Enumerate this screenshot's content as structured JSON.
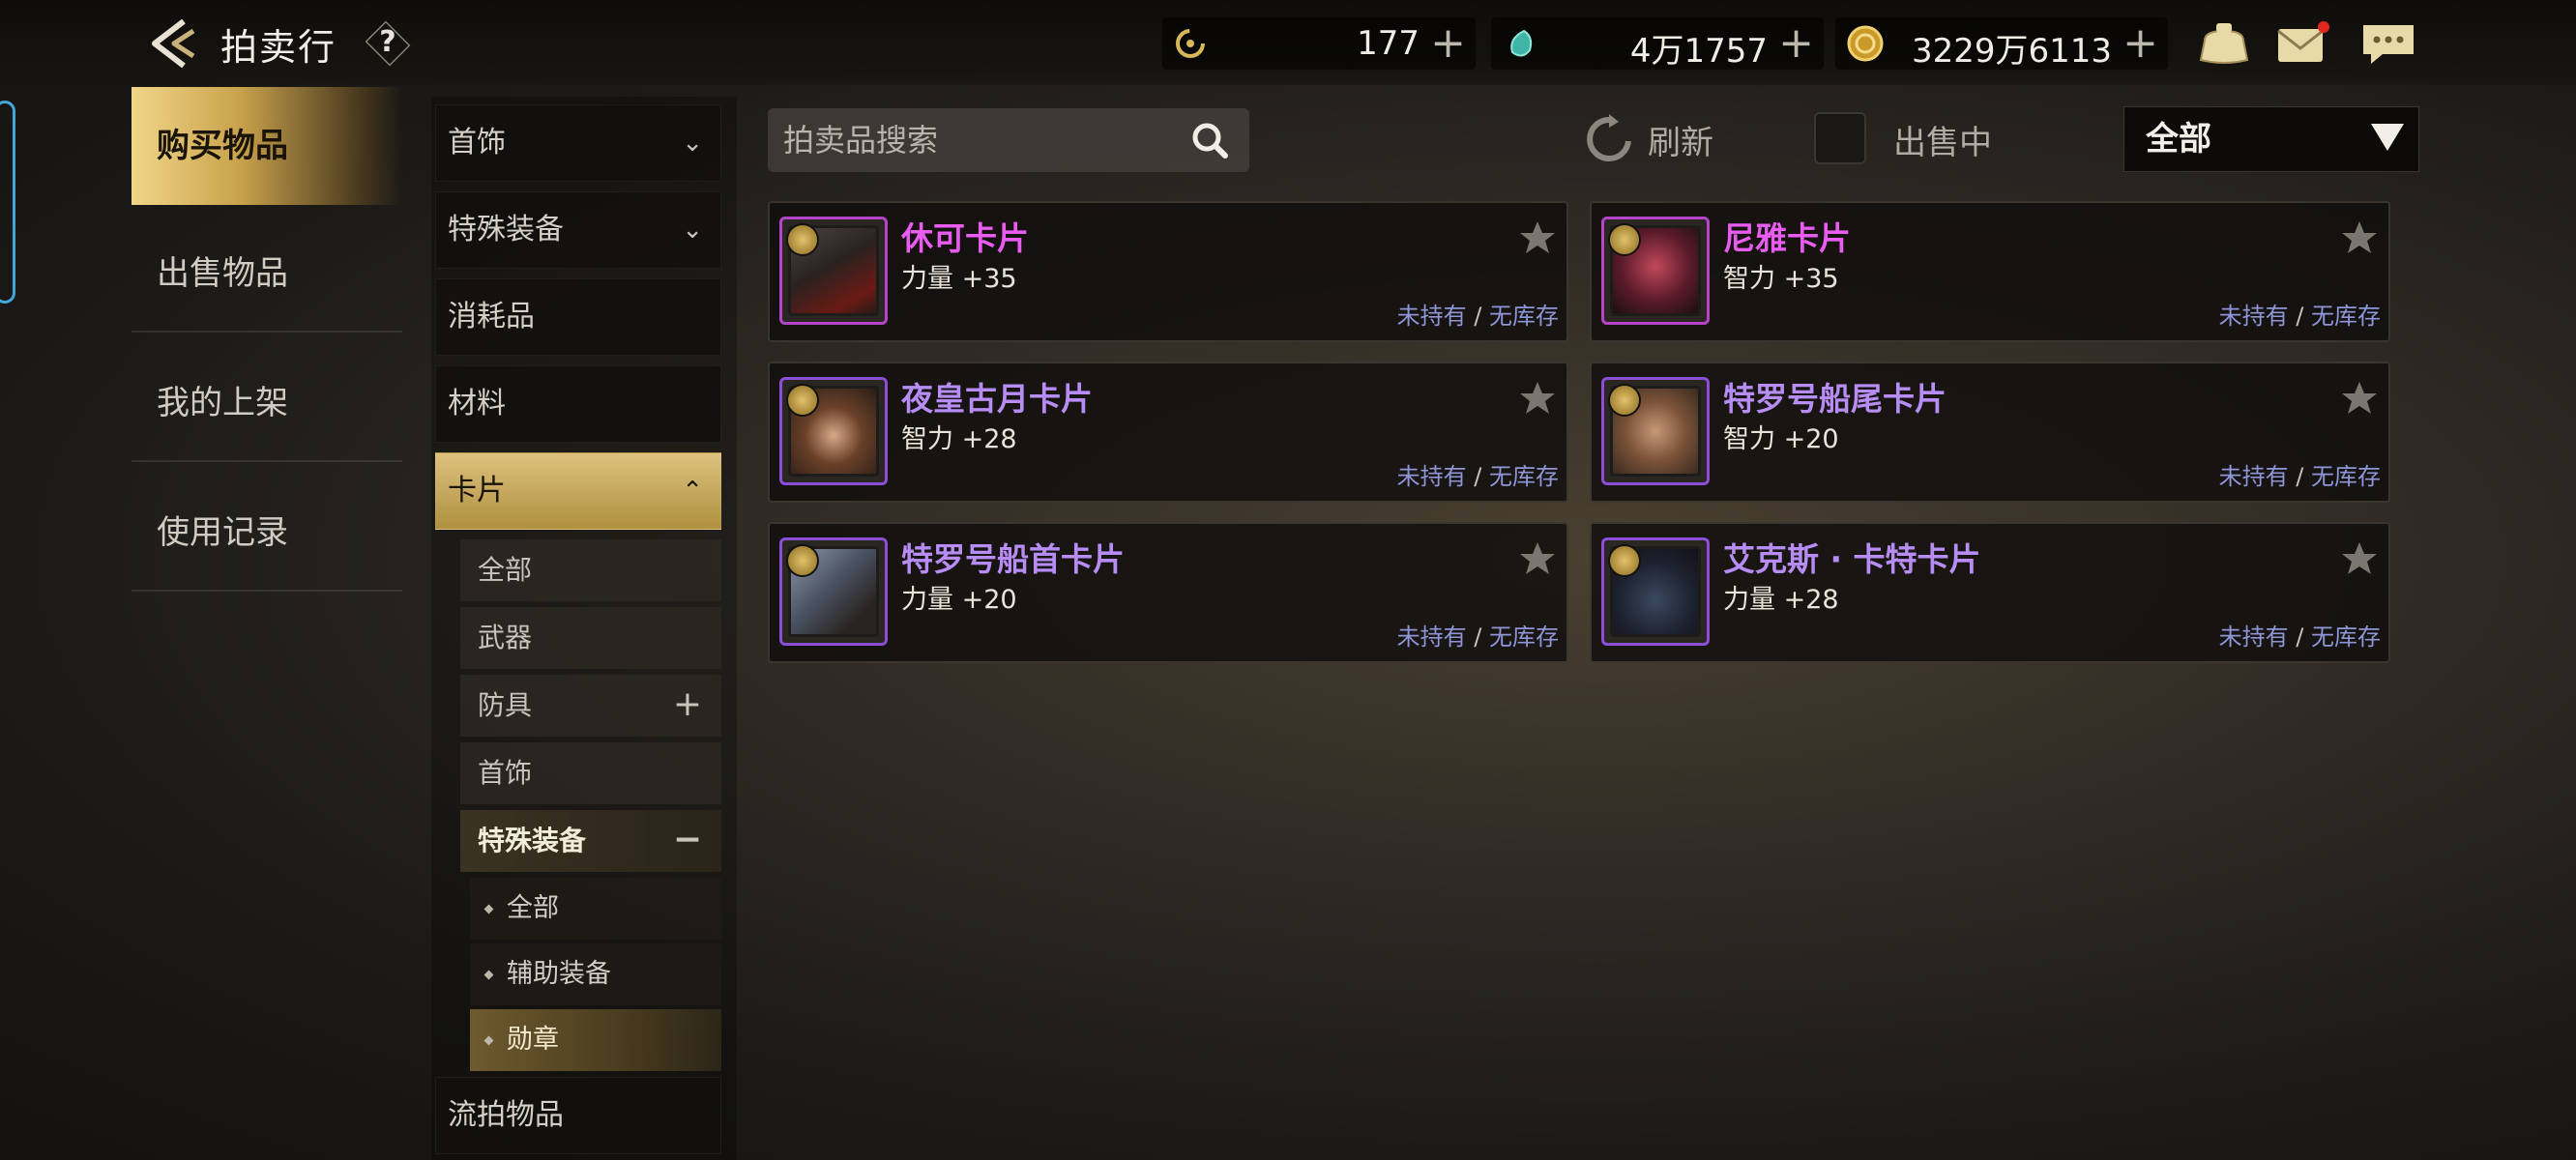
{
  "header": {
    "title": "拍卖行",
    "help_label": "?",
    "currencies": [
      {
        "icon": "ticket-coin-icon",
        "value": "177",
        "plus": "+"
      },
      {
        "icon": "crystal-gem-icon",
        "value": "4万1757",
        "plus": "+"
      },
      {
        "icon": "gold-coin-icon",
        "value": "3229万6113",
        "plus": "+"
      }
    ],
    "icons": [
      "bag-icon",
      "mail-icon",
      "chat-icon"
    ]
  },
  "left_nav": {
    "items": [
      {
        "label": "购买物品",
        "active": true
      },
      {
        "label": "出售物品",
        "active": false
      },
      {
        "label": "我的上架",
        "active": false
      },
      {
        "label": "使用记录",
        "active": false
      }
    ]
  },
  "categories": {
    "items": [
      {
        "label": "首饰",
        "chevron": "⌄"
      },
      {
        "label": "特殊装备",
        "chevron": "⌄"
      },
      {
        "label": "消耗品"
      },
      {
        "label": "材料"
      },
      {
        "label": "卡片",
        "chevron": "⌃",
        "open": true
      }
    ],
    "sub_items": [
      {
        "label": "全部"
      },
      {
        "label": "武器"
      },
      {
        "label": "防具",
        "toggle": "+"
      },
      {
        "label": "首饰"
      },
      {
        "label": "特殊装备",
        "toggle": "−",
        "active": true
      }
    ],
    "subsub_items": [
      {
        "label": "全部"
      },
      {
        "label": "辅助装备"
      },
      {
        "label": "勋章",
        "active": true
      }
    ],
    "last_item": {
      "label": "流拍物品"
    }
  },
  "toolbar": {
    "search_placeholder": "拍卖品搜索",
    "refresh_label": "刷新",
    "on_sale_label": "出售中",
    "filter_value": "全部"
  },
  "items": [
    {
      "name": "休可卡片",
      "stat": "力量 +35",
      "owned": "未持有",
      "sep": " / ",
      "stock": "无库存",
      "rarity": "pink"
    },
    {
      "name": "尼雅卡片",
      "stat": "智力 +35",
      "owned": "未持有",
      "sep": " / ",
      "stock": "无库存",
      "rarity": "pink"
    },
    {
      "name": "夜皇古月卡片",
      "stat": "智力 +28",
      "owned": "未持有",
      "sep": " / ",
      "stock": "无库存",
      "rarity": "purple"
    },
    {
      "name": "特罗号船尾卡片",
      "stat": "智力 +20",
      "owned": "未持有",
      "sep": " / ",
      "stock": "无库存",
      "rarity": "purple"
    },
    {
      "name": "特罗号船首卡片",
      "stat": "力量 +20",
      "owned": "未持有",
      "sep": " / ",
      "stock": "无库存",
      "rarity": "purple"
    },
    {
      "name": "艾克斯 · 卡特卡片",
      "stat": "力量 +28",
      "owned": "未持有",
      "sep": " / ",
      "stock": "无库存",
      "rarity": "purple"
    }
  ],
  "colors": {
    "pink_rarity": "#e85cf0",
    "purple_rarity": "#b78df5",
    "gold_accent": "#c9a24c",
    "status_blue": "#8e96d8"
  }
}
